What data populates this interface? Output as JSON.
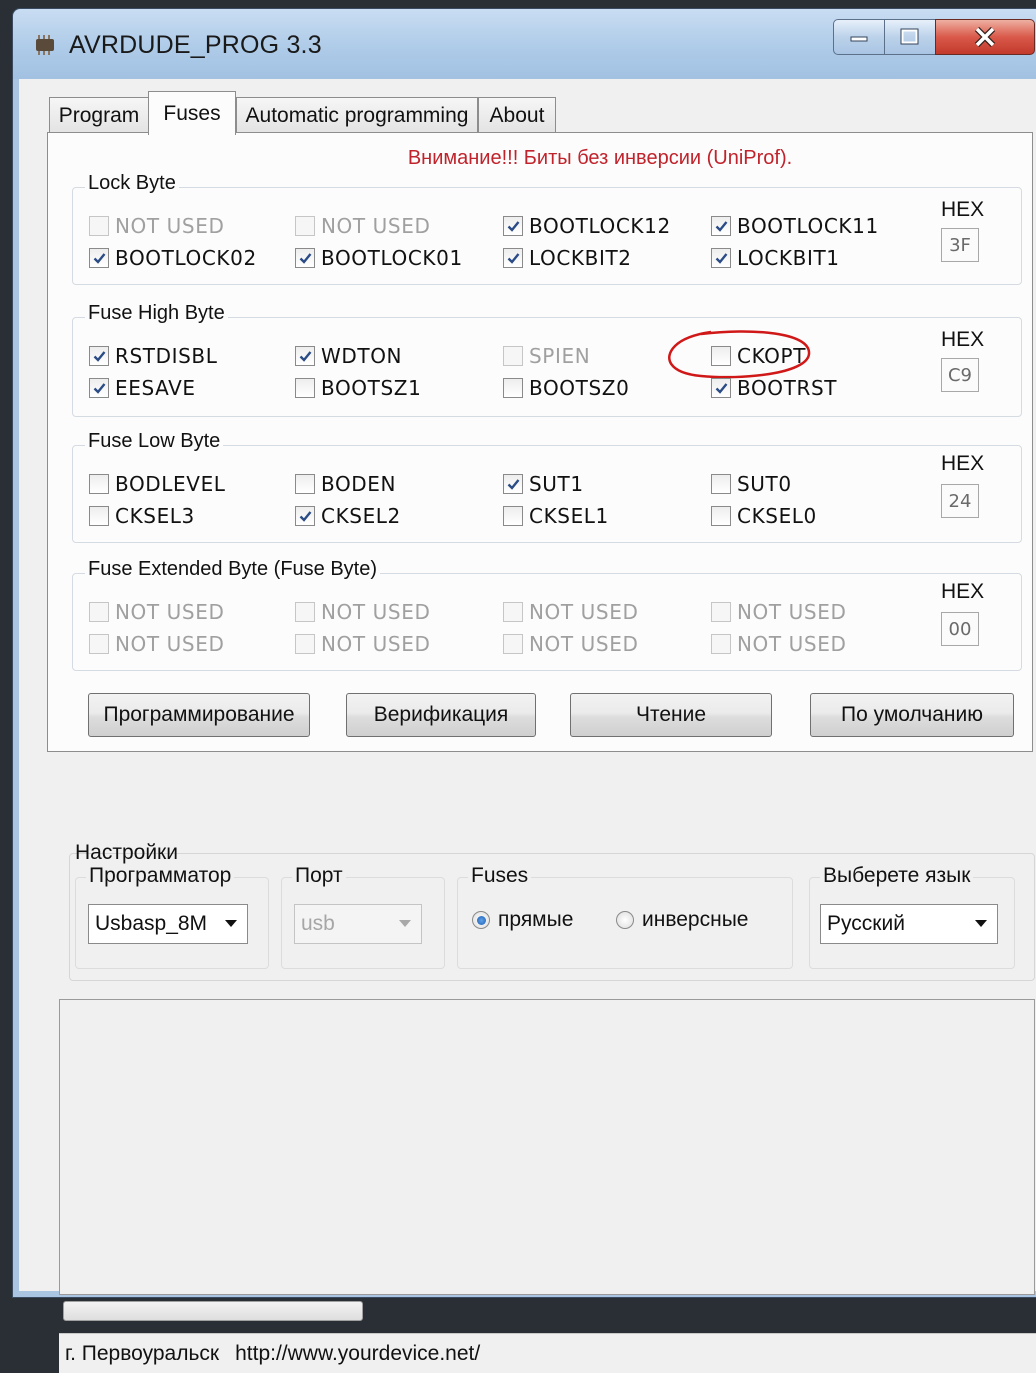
{
  "window": {
    "title": "AVRDUDE_PROG 3.3"
  },
  "tabs": [
    {
      "label": "Program",
      "active": false
    },
    {
      "label": "Fuses",
      "active": true
    },
    {
      "label": "Automatic programming",
      "active": false
    },
    {
      "label": "About",
      "active": false
    }
  ],
  "fuses": {
    "warning": "Внимание!!! Биты без инверсии (UniProf).",
    "hex_label": "HEX",
    "groups": [
      {
        "title": "Lock Byte",
        "hex": "3F",
        "bits": [
          {
            "label": "NOT USED",
            "checked": false,
            "disabled": true
          },
          {
            "label": "NOT USED",
            "checked": false,
            "disabled": true
          },
          {
            "label": "BOOTLOCK12",
            "checked": true,
            "disabled": false
          },
          {
            "label": "BOOTLOCK11",
            "checked": true,
            "disabled": false
          },
          {
            "label": "BOOTLOCK02",
            "checked": true,
            "disabled": false
          },
          {
            "label": "BOOTLOCK01",
            "checked": true,
            "disabled": false
          },
          {
            "label": "LOCKBIT2",
            "checked": true,
            "disabled": false
          },
          {
            "label": "LOCKBIT1",
            "checked": true,
            "disabled": false
          }
        ]
      },
      {
        "title": "Fuse High Byte",
        "hex": "C9",
        "bits": [
          {
            "label": "RSTDISBL",
            "checked": true,
            "disabled": false
          },
          {
            "label": "WDTON",
            "checked": true,
            "disabled": false
          },
          {
            "label": "SPIEN",
            "checked": false,
            "disabled": true
          },
          {
            "label": "CKOPT",
            "checked": false,
            "disabled": false
          },
          {
            "label": "EESAVE",
            "checked": true,
            "disabled": false
          },
          {
            "label": "BOOTSZ1",
            "checked": false,
            "disabled": false
          },
          {
            "label": "BOOTSZ0",
            "checked": false,
            "disabled": false
          },
          {
            "label": "BOOTRST",
            "checked": true,
            "disabled": false
          }
        ]
      },
      {
        "title": "Fuse Low Byte",
        "hex": "24",
        "bits": [
          {
            "label": "BODLEVEL",
            "checked": false,
            "disabled": false
          },
          {
            "label": "BODEN",
            "checked": false,
            "disabled": false
          },
          {
            "label": "SUT1",
            "checked": true,
            "disabled": false
          },
          {
            "label": "SUT0",
            "checked": false,
            "disabled": false
          },
          {
            "label": "CKSEL3",
            "checked": false,
            "disabled": false
          },
          {
            "label": "CKSEL2",
            "checked": true,
            "disabled": false
          },
          {
            "label": "CKSEL1",
            "checked": false,
            "disabled": false
          },
          {
            "label": "CKSEL0",
            "checked": false,
            "disabled": false
          }
        ]
      },
      {
        "title": "Fuse Extended Byte (Fuse Byte)",
        "hex": "00",
        "bits": [
          {
            "label": "NOT USED",
            "checked": false,
            "disabled": true
          },
          {
            "label": "NOT USED",
            "checked": false,
            "disabled": true
          },
          {
            "label": "NOT USED",
            "checked": false,
            "disabled": true
          },
          {
            "label": "NOT USED",
            "checked": false,
            "disabled": true
          },
          {
            "label": "NOT USED",
            "checked": false,
            "disabled": true
          },
          {
            "label": "NOT USED",
            "checked": false,
            "disabled": true
          },
          {
            "label": "NOT USED",
            "checked": false,
            "disabled": true
          },
          {
            "label": "NOT USED",
            "checked": false,
            "disabled": true
          }
        ]
      }
    ],
    "buttons": {
      "program": "Программирование",
      "verify": "Верификация",
      "read": "Чтение",
      "default": "По умолчанию"
    }
  },
  "settings": {
    "title": "Настройки",
    "programmer": {
      "label": "Программатор",
      "value": "Usbasp_8M"
    },
    "port": {
      "label": "Порт",
      "value": "usb"
    },
    "fuses": {
      "label": "Fuses",
      "direct": "прямые",
      "inverse": "инверсные",
      "selected": "direct"
    },
    "language": {
      "label": "Выберете язык",
      "value": "Русский"
    }
  },
  "status": {
    "city": "г. Первоуральск",
    "url": "http://www.yourdevice.net/"
  },
  "colors": {
    "warning": "#c0232b",
    "annotation": "#d01818"
  }
}
